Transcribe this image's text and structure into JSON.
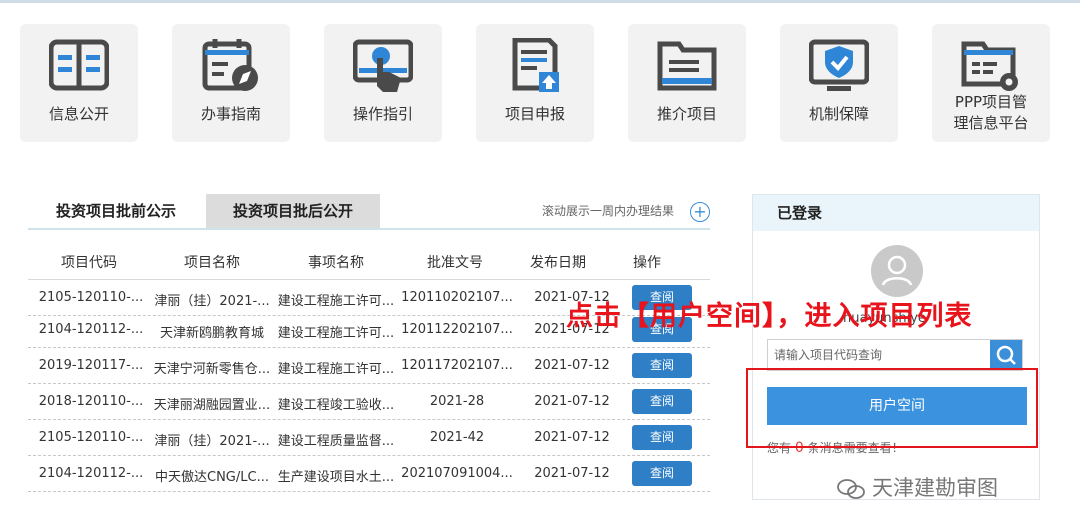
{
  "tiles": [
    {
      "label": "信息公开",
      "icon": "open-book-icon"
    },
    {
      "label": "办事指南",
      "icon": "calendar-compass-icon"
    },
    {
      "label": "操作指引",
      "icon": "touch-screen-icon"
    },
    {
      "label": "项目申报",
      "icon": "document-upload-icon"
    },
    {
      "label": "推介项目",
      "icon": "folder-list-icon"
    },
    {
      "label": "机制保障",
      "icon": "shield-check-icon"
    },
    {
      "label_line1": "PPP项目管",
      "label_line2": "理信息平台",
      "icon": "folder-gear-icon"
    }
  ],
  "tabs": {
    "tab1": "投资项目批前公示",
    "tab2": "投资项目批后公开",
    "roll_text": "滚动展示一周内办理结果",
    "plus": "+"
  },
  "table": {
    "headers": [
      "项目代码",
      "项目名称",
      "事项名称",
      "批准文号",
      "发布日期",
      "操作"
    ],
    "rows": [
      [
        "2105-120110-...",
        "津丽（挂）2021-...",
        "建设工程施工许可...",
        "120110202107...",
        "2021-07-12",
        "查阅"
      ],
      [
        "2104-120112-...",
        "天津新鸥鹏教育城",
        "建设工程施工许可...",
        "120112202107...",
        "2021-07-12",
        "查阅"
      ],
      [
        "2019-120117-...",
        "天津宁河新零售仓...",
        "建设工程施工许可...",
        "120117202107...",
        "2021-07-12",
        "查阅"
      ],
      [
        "2018-120110-...",
        "天津丽湖融园置业...",
        "建设工程竣工验收...",
        "2021-28",
        "2021-07-12",
        "查阅"
      ],
      [
        "2105-120110-...",
        "津丽（挂）2021-...",
        "建设工程质量监督...",
        "2021-42",
        "2021-07-12",
        "查阅"
      ],
      [
        "2104-120112-...",
        "中天傲达CNG/LC...",
        "生产建设项目水土...",
        "202107091004...",
        "2021-07-12",
        "查阅"
      ]
    ]
  },
  "side": {
    "title": "已登录",
    "username": "huayunshiye",
    "search_placeholder": "请输入项目代码查询",
    "user_space_button": "用户空间",
    "msg_prefix": "您有",
    "msg_count": "0",
    "msg_suffix": "条消息需要查看！"
  },
  "annotation": "点击【用户空间】，进入项目列表",
  "watermark": "天津建勘审图",
  "colors": {
    "accent": "#3b92de",
    "highlight": "#e4151b",
    "tab_active": "#dcdcdc"
  }
}
